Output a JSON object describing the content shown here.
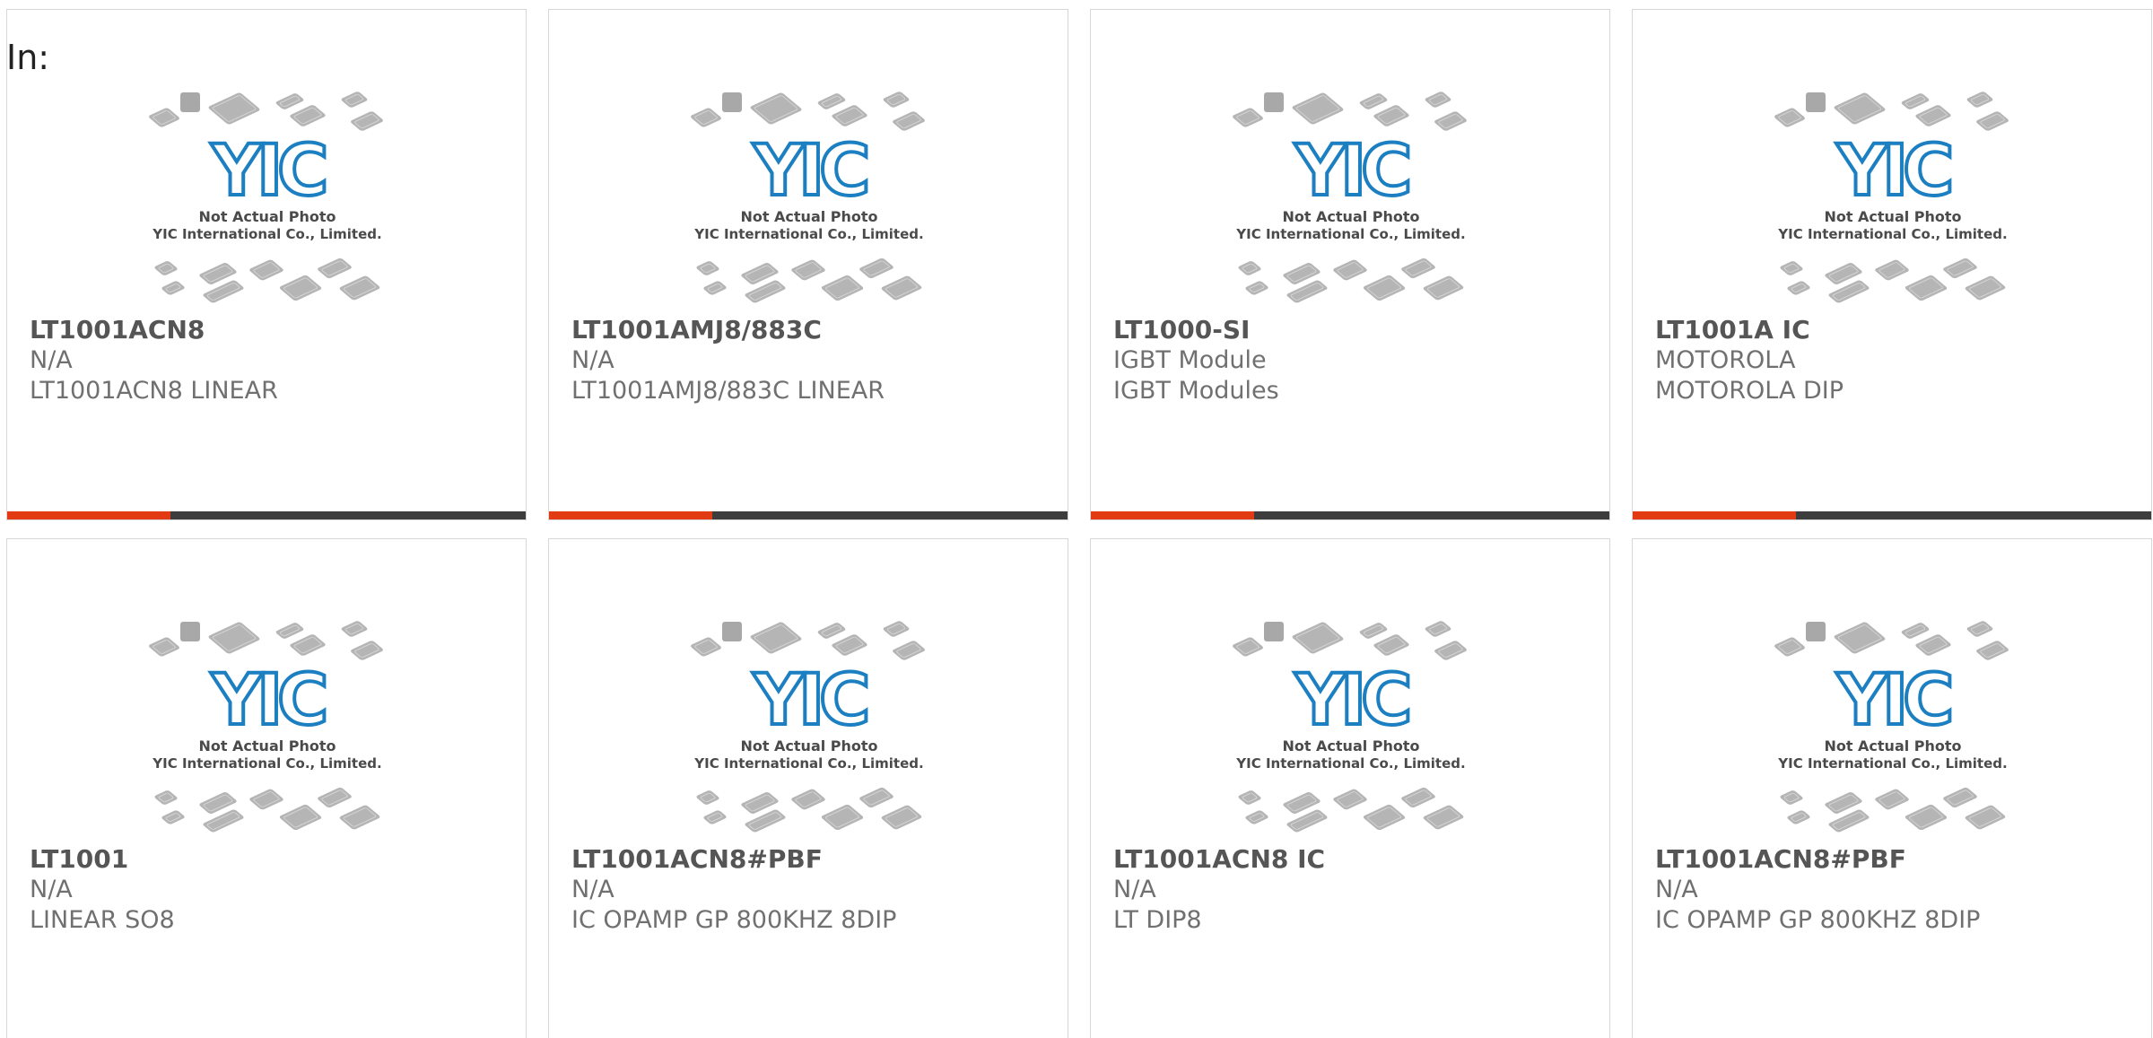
{
  "header": {
    "label": "In:"
  },
  "placeholder": {
    "line1": "Not Actual Photo",
    "line2": "YIC International Co., Limited.",
    "logo_text": "YIC",
    "logo_color": "#1b7fc1",
    "chip_color": "#b5b5b5"
  },
  "accent_color": "#e23b14",
  "bar_color": "#3d3d3d",
  "products": [
    {
      "part": "LT1001ACN8",
      "line1": "N/A",
      "line2": "LT1001ACN8 LINEAR"
    },
    {
      "part": "LT1001AMJ8/883C",
      "line1": "N/A",
      "line2": "LT1001AMJ8/883C LINEAR"
    },
    {
      "part": "LT1000-SI",
      "line1": "IGBT Module",
      "line2": "IGBT Modules"
    },
    {
      "part": "LT1001A IC",
      "line1": "MOTOROLA",
      "line2": "MOTOROLA DIP"
    },
    {
      "part": "LT1001",
      "line1": "N/A",
      "line2": "LINEAR SO8"
    },
    {
      "part": "LT1001ACN8#PBF",
      "line1": "N/A",
      "line2": "IC OPAMP GP 800KHZ 8DIP"
    },
    {
      "part": "LT1001ACN8 IC",
      "line1": "N/A",
      "line2": "LT DIP8"
    },
    {
      "part": "LT1001ACN8#PBF",
      "line1": "N/A",
      "line2": "IC OPAMP GP 800KHZ 8DIP"
    }
  ]
}
